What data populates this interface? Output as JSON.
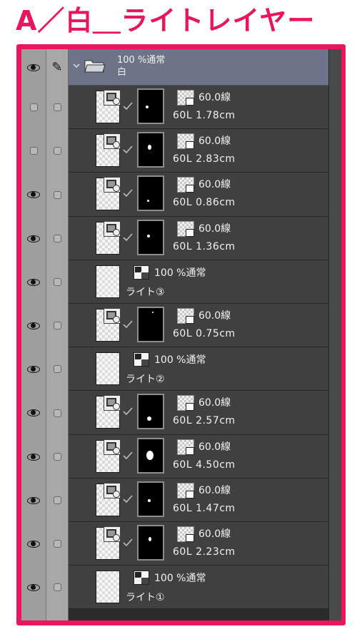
{
  "heading": "A／白＿ライトレイヤー",
  "colors": {
    "accent": "#e8175d",
    "panel_bg": "#404040",
    "folder_bg": "#6d7487"
  },
  "folder": {
    "blend": "100 %通常",
    "name": "白",
    "icons": {
      "visibility": "eye-icon",
      "lock": "pencil-icon",
      "expand": "chevron-down-icon",
      "folder": "folder-open-icon"
    }
  },
  "layers": [
    {
      "kind": "line",
      "visible": false,
      "opacity": "60.0線",
      "info": "60L 1.78cm",
      "mask_dot": {
        "rx": 0.35,
        "ry": 0.52,
        "w": 4,
        "h": 4
      }
    },
    {
      "kind": "line",
      "visible": false,
      "opacity": "60.0線",
      "info": "60L 2.83cm",
      "mask_dot": {
        "rx": 0.45,
        "ry": 0.42,
        "w": 5,
        "h": 7
      }
    },
    {
      "kind": "line",
      "visible": true,
      "opacity": "60.0線",
      "info": "60L 0.86cm",
      "mask_dot": {
        "rx": 0.4,
        "ry": 0.72,
        "w": 3,
        "h": 3
      }
    },
    {
      "kind": "line",
      "visible": true,
      "opacity": "60.0線",
      "info": "60L 1.36cm",
      "mask_dot": {
        "rx": 0.42,
        "ry": 0.45,
        "w": 4,
        "h": 4
      }
    },
    {
      "kind": "raster",
      "visible": true,
      "blend": "100 %通常",
      "name": "ライト③"
    },
    {
      "kind": "line",
      "visible": true,
      "opacity": "60.0線",
      "info": "60L 0.75cm",
      "mask_dot": {
        "rx": 0.6,
        "ry": 0.12,
        "w": 2,
        "h": 2
      }
    },
    {
      "kind": "raster",
      "visible": true,
      "blend": "100 %通常",
      "name": "ライト②"
    },
    {
      "kind": "line",
      "visible": true,
      "opacity": "60.0線",
      "info": "60L 2.57cm",
      "mask_dot": {
        "rx": 0.45,
        "ry": 0.72,
        "w": 6,
        "h": 6
      }
    },
    {
      "kind": "line",
      "visible": true,
      "opacity": "60.0線",
      "info": "60L 4.50cm",
      "mask_dot": {
        "rx": 0.48,
        "ry": 0.48,
        "w": 10,
        "h": 13
      }
    },
    {
      "kind": "line",
      "visible": true,
      "opacity": "60.0線",
      "info": "60L 1.47cm",
      "mask_dot": {
        "rx": 0.45,
        "ry": 0.55,
        "w": 4,
        "h": 4
      }
    },
    {
      "kind": "line",
      "visible": true,
      "opacity": "60.0線",
      "info": "60L 2.23cm",
      "mask_dot": {
        "rx": 0.48,
        "ry": 0.4,
        "w": 4,
        "h": 6
      }
    },
    {
      "kind": "raster",
      "visible": true,
      "blend": "100 %通常",
      "name": "ライト①"
    }
  ]
}
